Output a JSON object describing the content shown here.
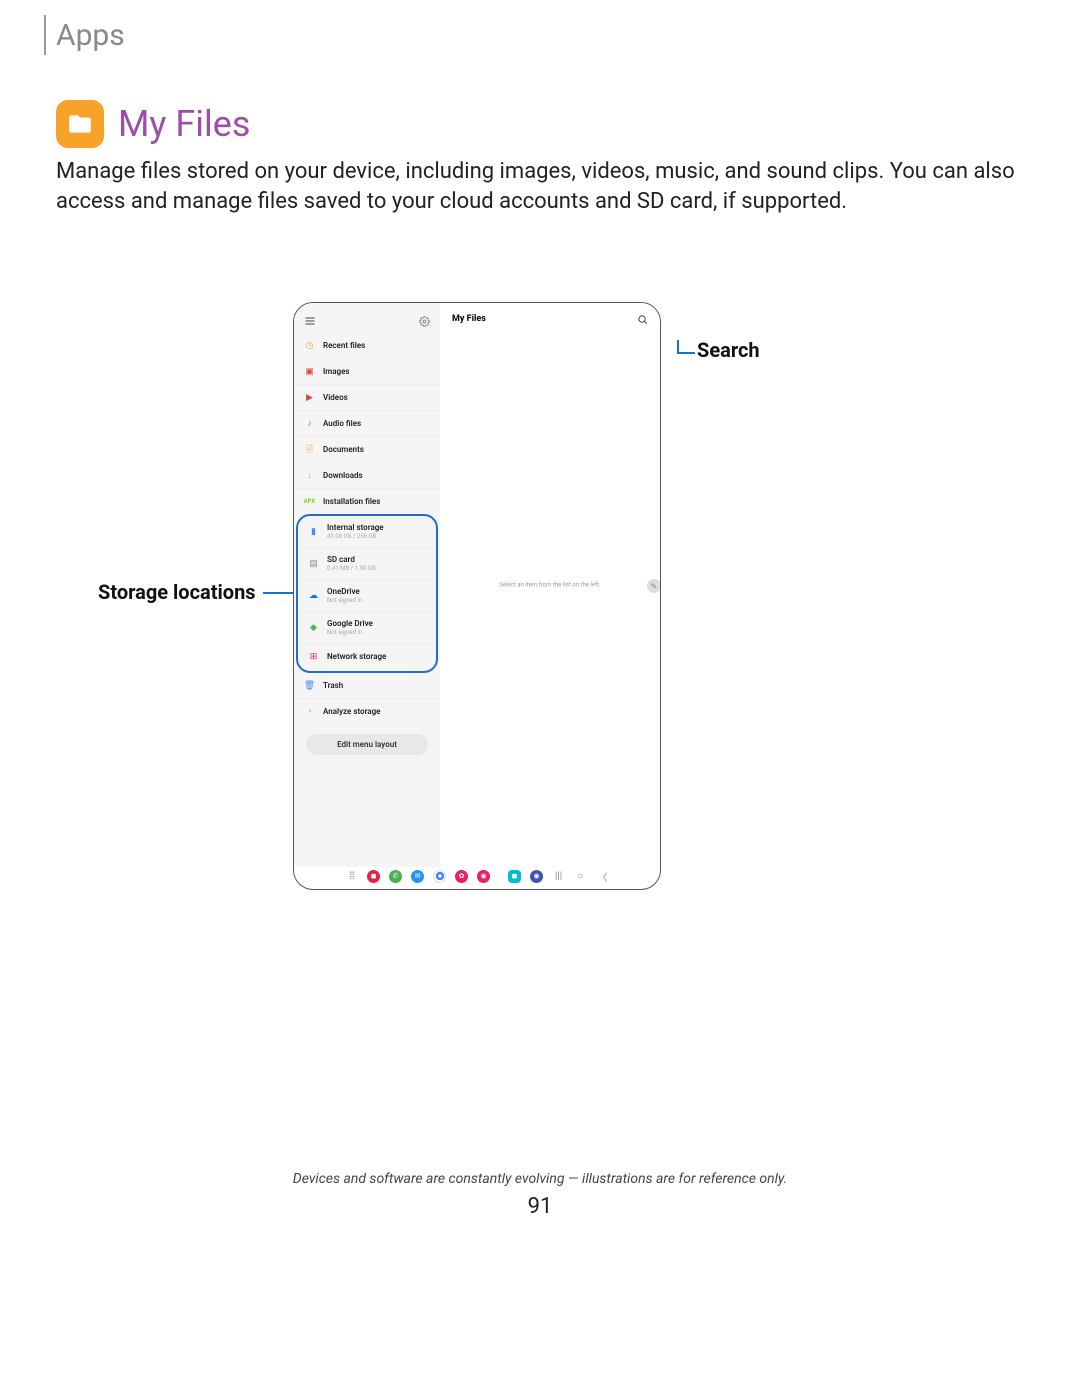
{
  "header": {
    "section": "Apps"
  },
  "title": "My Files",
  "intro": "Manage files stored on your device, including images, videos, music, and sound clips. You can also access and manage files saved to your cloud accounts and SD card, if supported.",
  "callouts": {
    "search": "Search",
    "storage": "Storage locations"
  },
  "device": {
    "sidebar": {
      "items": [
        {
          "label": "Recent files"
        },
        {
          "label": "Images"
        },
        {
          "label": "Videos"
        },
        {
          "label": "Audio files"
        },
        {
          "label": "Documents"
        },
        {
          "label": "Downloads"
        },
        {
          "label": "Installation files"
        }
      ],
      "storage": [
        {
          "label": "Internal storage",
          "sub": "43.08 GB / 256 GB"
        },
        {
          "label": "SD card",
          "sub": "0.41 MB / 1.90 GB"
        },
        {
          "label": "OneDrive",
          "sub": "Not signed in"
        },
        {
          "label": "Google Drive",
          "sub": "Not signed in"
        },
        {
          "label": "Network storage",
          "sub": ""
        }
      ],
      "trash": "Trash",
      "analyze": "Analyze storage",
      "edit_button": "Edit menu layout"
    },
    "main": {
      "title": "My Files",
      "empty": "Select an item from the list on the left."
    }
  },
  "footer": "Devices and software are constantly evolving — illustrations are for reference only.",
  "page": "91"
}
